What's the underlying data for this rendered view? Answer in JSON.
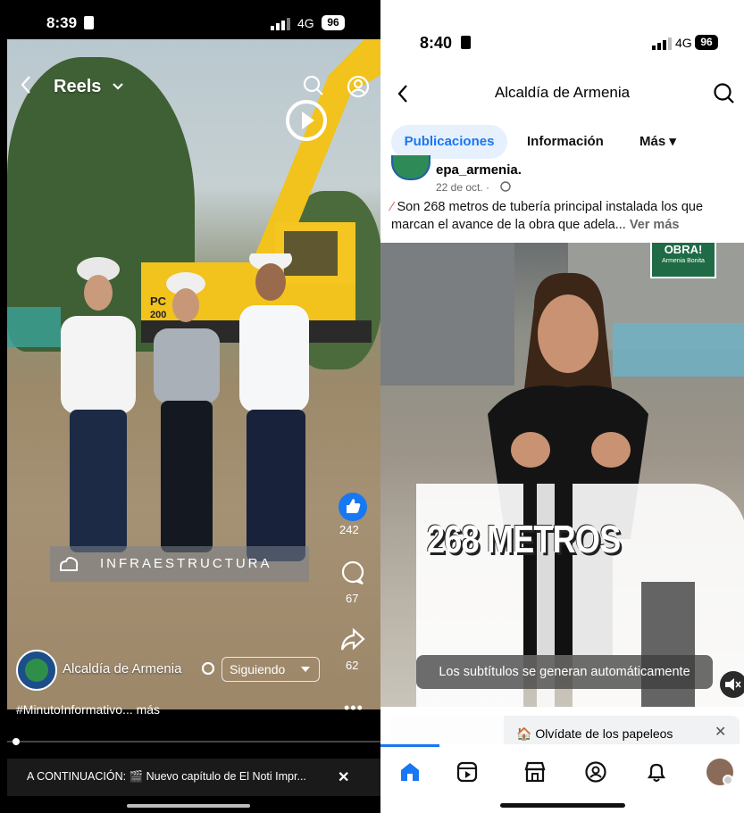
{
  "left": {
    "status": {
      "time": "8:39",
      "network": "4G",
      "battery": "96"
    },
    "header": {
      "title": "Reels"
    },
    "overlay_label": "INFRAESTRUCTURA",
    "actions": {
      "likes": "242",
      "comments": "67",
      "shares": "62"
    },
    "account": {
      "name": "Alcaldía de Armenia",
      "follow_label": "Siguiendo"
    },
    "caption": "#MinutoInformativo... más",
    "next_banner": {
      "text": "A CONTINUACIÓN: 🎬 Nuevo capítulo de El Noti Impr...",
      "close": "✕"
    }
  },
  "right": {
    "status": {
      "time": "8:40",
      "network": "4G",
      "battery": "96"
    },
    "nav": {
      "title": "Alcaldía de Armenia"
    },
    "tabs": [
      {
        "label": "Publicaciones"
      },
      {
        "label": "Información"
      },
      {
        "label": "Más ▾"
      }
    ],
    "post": {
      "author": "epa_armenia.",
      "date": "22 de oct. · ",
      "text": "Son 268 metros de tubería principal instalada los que marcan el avance de la obra que adela...",
      "more": "Ver más"
    },
    "video": {
      "badge_top": "OBRA!",
      "badge_sub": "Armenia Bonita",
      "headline": "268 METROS",
      "subtitle_notice": "Los subtítulos se generan automáticamente"
    },
    "ad": {
      "text": "🏠 Olvídate de los papeleos",
      "close": "✕"
    }
  },
  "colors": {
    "fb_blue": "#1877f2",
    "tab_bg": "#e7f0fd",
    "reels_like_blue": "#1877f2"
  }
}
